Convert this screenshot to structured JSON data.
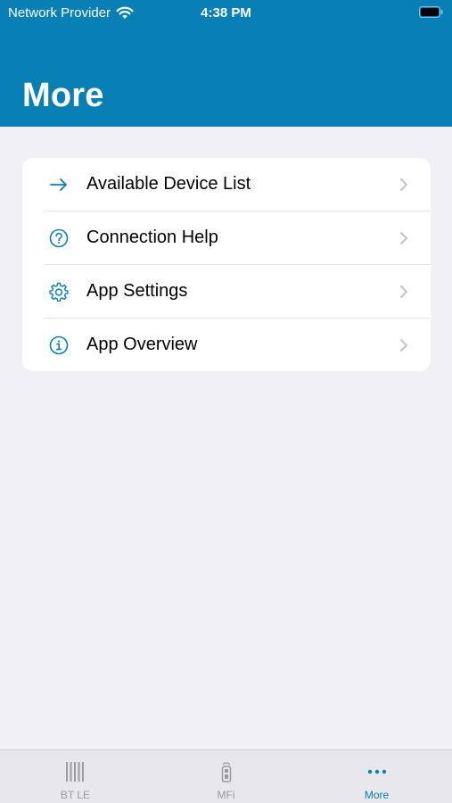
{
  "status_bar": {
    "carrier": "Network Provider",
    "time": "4:38 PM"
  },
  "header": {
    "title": "More"
  },
  "menu": {
    "items": [
      {
        "label": "Available Device List",
        "icon": "arrow-right-icon"
      },
      {
        "label": "Connection Help",
        "icon": "question-circle-icon"
      },
      {
        "label": "App Settings",
        "icon": "gear-icon"
      },
      {
        "label": "App Overview",
        "icon": "info-circle-icon"
      }
    ]
  },
  "tabbar": {
    "tabs": [
      {
        "label": "BT LE",
        "icon": "barcode-icon",
        "active": false
      },
      {
        "label": "MFi",
        "icon": "scanner-icon",
        "active": false
      },
      {
        "label": "More",
        "icon": "more-dots-icon",
        "active": true
      }
    ]
  },
  "colors": {
    "brand": "#0980b5",
    "background": "#f0f0f5",
    "tab_inactive": "#9a9aa0"
  }
}
